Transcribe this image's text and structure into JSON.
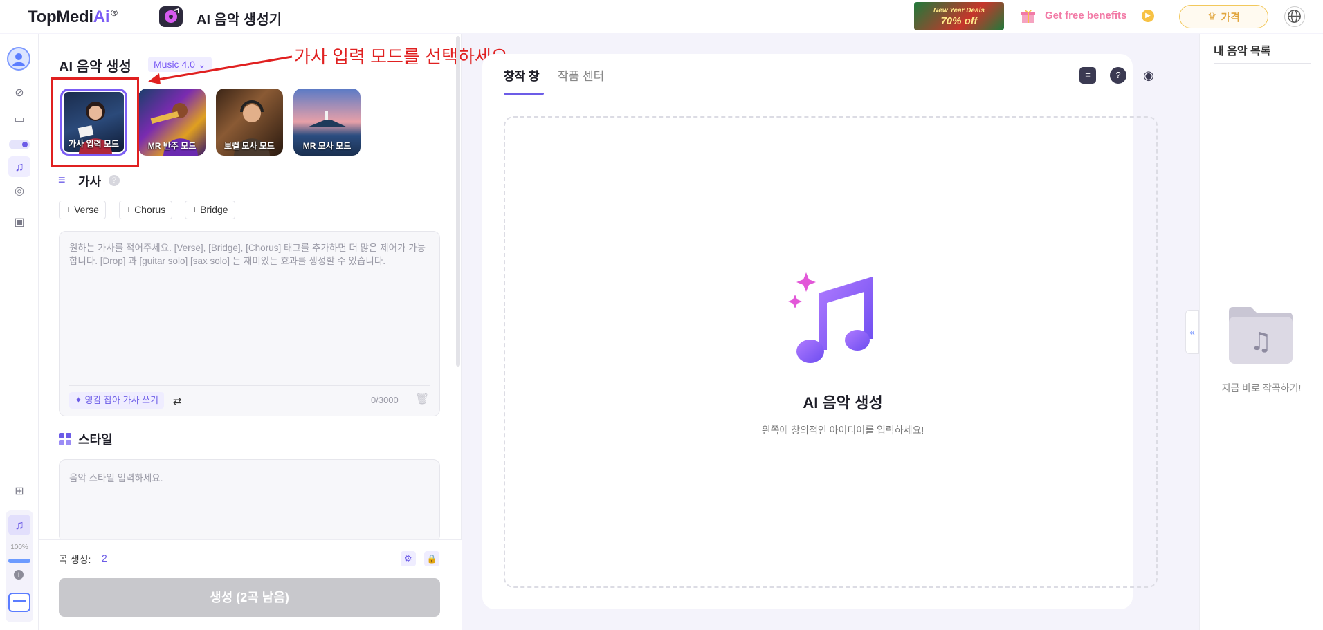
{
  "header": {
    "logo_main": "TopMedi",
    "logo_ai": "Ai",
    "logo_reg": "®",
    "app_title": "AI 음악 생성기",
    "promo_line1": "New Year Deals",
    "promo_line2": "70% off",
    "benefits": "Get free benefits",
    "price_button": "가격"
  },
  "rail": {
    "percent": "100%"
  },
  "panel": {
    "title": "AI 음악 생성",
    "model": "Music 4.0",
    "modes": [
      {
        "label": "가사 입력 모드"
      },
      {
        "label": "MR 반주 모드"
      },
      {
        "label": "보컬 모사 모드"
      },
      {
        "label": "MR 모사 모드"
      }
    ],
    "annotation": "가사 입력 모드를 선택하세요.",
    "lyrics_title": "가사",
    "tags": {
      "verse": "+ Verse",
      "chorus": "+ Chorus",
      "bridge": "+ Bridge"
    },
    "lyrics_placeholder": "원하는 가사를 적어주세요. [Verse], [Bridge], [Chorus] 태그를 추가하면 더 많은 제어가 가능합니다. [Drop] 과 [guitar solo] [sax solo] 는 재미있는 효과를 생성할 수 있습니다.",
    "inspiration": "영감 잡아 가사 쓰기",
    "lyrics_count": "0/3000",
    "style_title": "스타일",
    "style_placeholder": "음악 스타일 입력하세요.",
    "song_count_label": "곡 생성:",
    "song_count_value": "2",
    "generate_button": "생성 (2곡 남음)"
  },
  "center": {
    "tab_create": "창작 창",
    "tab_works": "작품 센터",
    "empty_title": "AI 음악 생성",
    "empty_subtitle": "왼쪽에 창의적인 아이디어를 입력하세요!"
  },
  "right": {
    "title": "내 음악 목록",
    "empty_text": "지금 바로 작곡하기!"
  },
  "colors": {
    "accent": "#6c5ce7",
    "annotation": "#e02020"
  }
}
